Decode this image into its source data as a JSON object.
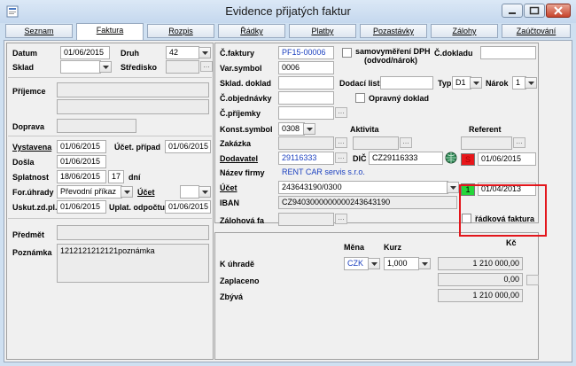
{
  "window": {
    "title": "Evidence přijatých faktur"
  },
  "tabs": [
    {
      "label": "Seznam",
      "active": false
    },
    {
      "label": "Faktura",
      "active": true
    },
    {
      "label": "Rozpis",
      "active": false
    },
    {
      "label": "Řádky",
      "active": false
    },
    {
      "label": "Platby",
      "active": false
    },
    {
      "label": "Pozastávky",
      "active": false
    },
    {
      "label": "Zálohy",
      "active": false
    },
    {
      "label": "Zaúčtování",
      "active": false
    }
  ],
  "left": {
    "datum_label": "Datum",
    "datum": "01/06/2015",
    "druh_label": "Druh",
    "druh": "42",
    "sklad_label": "Sklad",
    "sklad": "",
    "stredisko_label": "Středisko",
    "stredisko": "",
    "prijemce_label": "Příjemce",
    "doprava_label": "Doprava",
    "doprava": "",
    "vystavena_label": "Vystavena",
    "vystavena": "01/06/2015",
    "ucet_pripad_label": "Účet. případ",
    "ucet_pripad": "01/06/2015",
    "dosla_label": "Došla",
    "dosla": "01/06/2015",
    "splatnost_label": "Splatnost",
    "splatnost": "18/06/2015",
    "splatnost_dni": "17",
    "dni_label": "dní",
    "for_uhrady_label": "For.úhrady",
    "for_uhrady": "Převodní příkaz",
    "ucet_label": "Účet",
    "ucet": "",
    "uskut_label": "Uskut.zd.pl.",
    "uskut": "01/06/2015",
    "uplat_label": "Uplat. odpočtu",
    "uplat": "01/06/2015",
    "predmet_label": "Předmět",
    "predmet": "",
    "poznamka_label": "Poznámka",
    "poznamka": "1212121212121poznámka"
  },
  "right": {
    "c_faktury_label": "Č.faktury",
    "c_faktury": "PF15-00006",
    "samovymereni_label": "samovyměření DPH",
    "samovymereni_sub": "(odvod/nárok)",
    "c_dokladu_label": "Č.dokladu",
    "c_dokladu": "",
    "var_symbol_label": "Var.symbol",
    "var_symbol": "0006",
    "sklad_doklad_label": "Sklad. doklad",
    "sklad_doklad": "",
    "dodaci_list_label": "Dodací list",
    "dodaci_list": "",
    "typ_label": "Typ",
    "typ": "D1",
    "narok_label": "Nárok",
    "narok": "1",
    "c_objednavky_label": "Č.objednávky",
    "c_objednavky": "",
    "opravny_doklad_label": "Opravný doklad",
    "c_prijemky_label": "Č.příjemky",
    "c_prijemky": "",
    "konst_symbol_label": "Konst.symbol",
    "konst_symbol": "0308",
    "aktivita_label": "Aktivita",
    "aktivita": "",
    "referent_label": "Referent",
    "referent": "",
    "zakazka_label": "Zakázka",
    "zakazka": "",
    "dodavatel_label": "Dodavatel",
    "dodavatel": "29116333",
    "dic_label": "DIČ",
    "dic": "CZ29116333",
    "nazev_firmy_label": "Název firmy",
    "nazev_firmy": "RENT CAR servis s.r.o.",
    "ucet_label": "Účet",
    "ucet": "243643190/0300",
    "iban_label": "IBAN",
    "iban": "CZ9403000000000243643190",
    "zalohova_fa_label": "Zálohová fa",
    "zalohova_fa": "",
    "radkova_faktura_label": "řádková faktura",
    "status1_symbol": "S",
    "status1_date": "01/06/2015",
    "status1_color": "#e8161a",
    "status2_symbol": "1",
    "status2_date": "01/04/2013",
    "status2_color": "#25d63a"
  },
  "totals": {
    "mena_label": "Měna",
    "kurz_label": "Kurz",
    "kc_label": "Kč",
    "mena": "CZK",
    "kurz": "1,000",
    "k_uhrade_label": "K úhradě",
    "k_uhrade": "1 210 000,00",
    "zaplaceno_label": "Zaplaceno",
    "zaplaceno": "0,00",
    "zbyva_label": "Zbývá",
    "zbyva": "1 210 000,00"
  }
}
